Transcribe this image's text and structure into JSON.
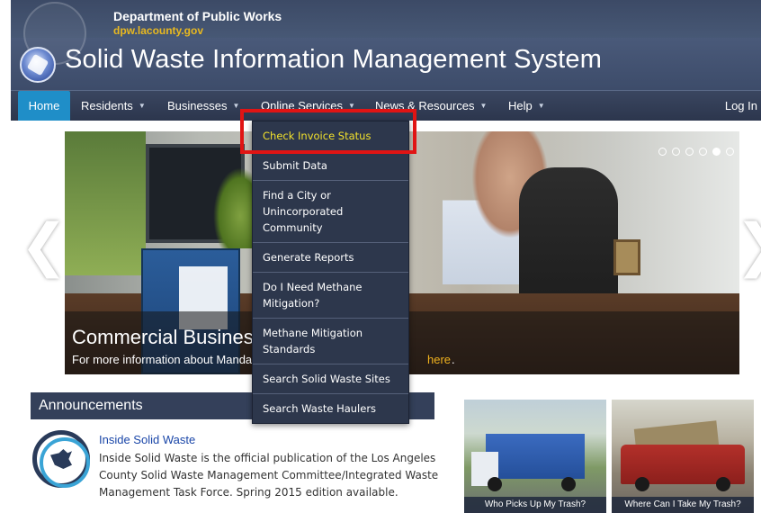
{
  "header": {
    "department": "Department of Public Works",
    "department_url": "dpw.lacounty.gov",
    "app_title": "Solid Waste Information Management System"
  },
  "nav": {
    "items": [
      {
        "label": "Home",
        "has_menu": false,
        "active": true
      },
      {
        "label": "Residents",
        "has_menu": true
      },
      {
        "label": "Businesses",
        "has_menu": true
      },
      {
        "label": "Online Services",
        "has_menu": true
      },
      {
        "label": "News & Resources",
        "has_menu": true
      },
      {
        "label": "Help",
        "has_menu": true
      }
    ],
    "login": "Log In"
  },
  "dropdown": {
    "parent": "Online Services",
    "items": [
      {
        "label": "Check Invoice Status",
        "highlight": true
      },
      {
        "label": "Submit Data"
      },
      {
        "label": "Find a City or Unincorporated Community"
      },
      {
        "label": "Generate Reports"
      },
      {
        "label": "Do I Need Methane Mitigation?"
      },
      {
        "label": "Methane Mitigation Standards"
      },
      {
        "label": "Search Solid Waste Sites"
      },
      {
        "label": "Search Waste Haulers"
      }
    ]
  },
  "hero": {
    "title": "Commercial Business",
    "text": "For more information about Mandat",
    "link": "here",
    "period": ".",
    "prev_arrow": "❮",
    "next_arrow": "❯",
    "slide_count": 6,
    "active_slide": 5
  },
  "announcements": {
    "heading": "Announcements",
    "items": [
      {
        "title": "Inside Solid Waste",
        "body": "Inside Solid Waste is the official publication of the Los Angeles County Solid Waste Management Committee/Integrated Waste Management Task Force. Spring 2015 edition available."
      }
    ]
  },
  "thumbnails": [
    {
      "caption": "Who Picks Up My Trash?"
    },
    {
      "caption": "Where Can I Take My Trash?"
    }
  ],
  "colors": {
    "nav_active": "#1f8ec8",
    "dropdown_bg": "#2d374c",
    "highlight_text": "#f2e12c",
    "focus_outline": "#e01414",
    "link": "#1a46a8",
    "caption_link": "#f0b21e"
  }
}
